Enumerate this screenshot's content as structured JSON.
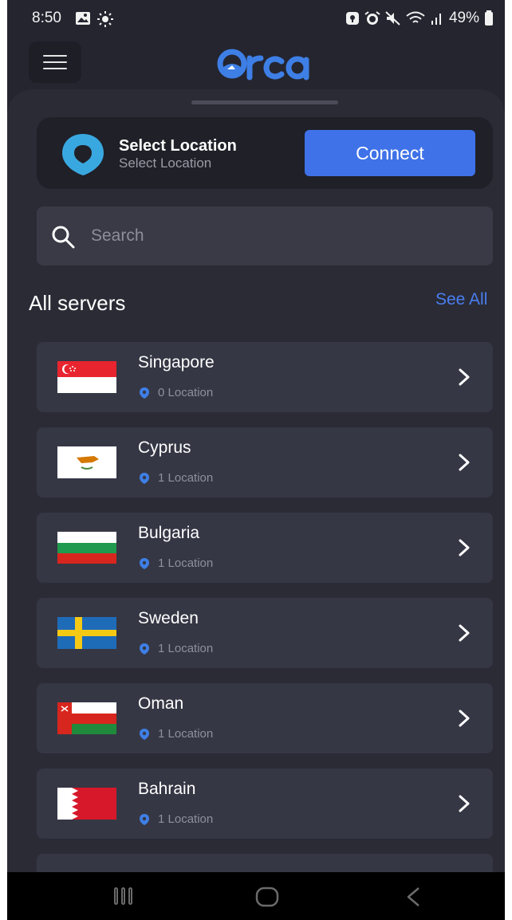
{
  "status_bar": {
    "time": "8:50",
    "battery": "49%",
    "left_icons": [
      "gallery-icon",
      "brightness-icon"
    ],
    "right_icons": [
      "vpn-key-icon",
      "alarm-icon",
      "mute-icon",
      "wifi-icon",
      "signal-icon",
      "battery-icon"
    ]
  },
  "app": {
    "logo_text": "Orca",
    "menu_icon": "hamburger-menu-icon"
  },
  "location_card": {
    "title": "Select Location",
    "subtitle": "Select Location",
    "connect_label": "Connect",
    "accent_color": "#3f72e8",
    "pin_color": "#3aa8e0"
  },
  "search": {
    "placeholder": "Search",
    "value": ""
  },
  "servers_section": {
    "title": "All servers",
    "see_all_label": "See All"
  },
  "servers": [
    {
      "name": "Singapore",
      "count": "0 Location",
      "flag": "sg"
    },
    {
      "name": "Cyprus",
      "count": "1 Location",
      "flag": "cy"
    },
    {
      "name": "Bulgaria",
      "count": "1 Location",
      "flag": "bg"
    },
    {
      "name": "Sweden",
      "count": "1 Location",
      "flag": "se"
    },
    {
      "name": "Oman",
      "count": "1 Location",
      "flag": "om"
    },
    {
      "name": "Bahrain",
      "count": "1 Location",
      "flag": "bh"
    }
  ],
  "nav_bar": {
    "buttons": [
      "recent-apps-icon",
      "home-icon",
      "back-icon"
    ]
  }
}
